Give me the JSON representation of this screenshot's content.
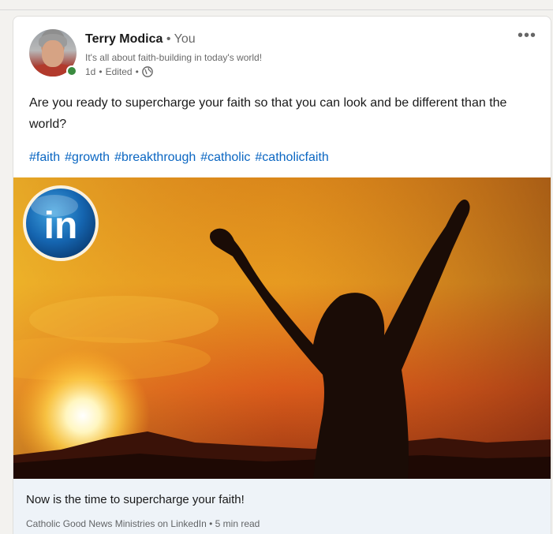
{
  "post": {
    "author": {
      "name": "Terry Modica",
      "separator": "•",
      "relation": "You",
      "tagline": "It's all about faith-building in today's world!",
      "time": "1d",
      "edited": "Edited",
      "visibility_icon": "globe-icon",
      "online_status": "online"
    },
    "more_icon": "more-icon",
    "more_label": "•••",
    "text": "Are you ready to supercharge your faith so that you can look and be different than the world?",
    "hashtags": [
      "#faith",
      "#growth",
      "#breakthrough",
      "#catholic",
      "#catholicfaith"
    ],
    "image": {
      "badge_text": "in",
      "badge_icon": "linkedin-logo-icon"
    },
    "link": {
      "title": "Now is the time to supercharge your faith!",
      "subtitle": "Catholic Good News Ministries on LinkedIn • 5 min read"
    }
  },
  "colors": {
    "hashtag": "#0a66c2",
    "link_footer_bg": "#eef3f8",
    "online_dot": "#3a8b3f"
  }
}
